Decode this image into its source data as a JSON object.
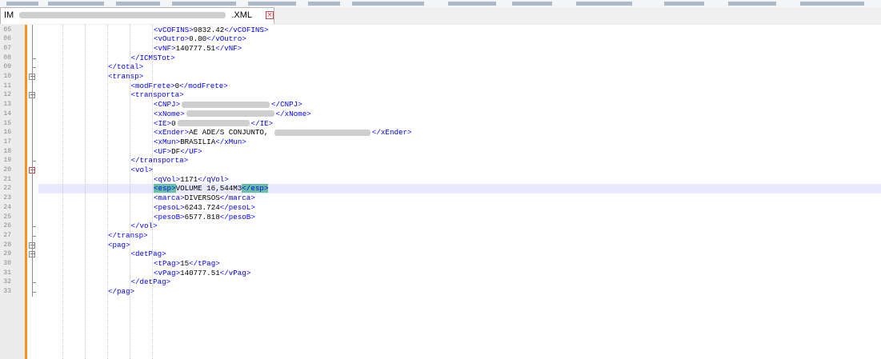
{
  "tab": {
    "label_prefix": "IM",
    "label_suffix": ".XML",
    "close_glyph": "×"
  },
  "editor": {
    "lines": [
      {
        "num": "05",
        "indent": 5,
        "tag": "vCOFINS",
        "value": "9832.42"
      },
      {
        "num": "06",
        "indent": 5,
        "tag": "vOutro",
        "value": "0.00"
      },
      {
        "num": "07",
        "indent": 5,
        "tag": "vNF",
        "value": "140777.51"
      },
      {
        "num": "08",
        "indent": 4,
        "close": "ICMSTot"
      },
      {
        "num": "09",
        "indent": 3,
        "close": "total"
      },
      {
        "num": "10",
        "indent": 3,
        "open": "transp"
      },
      {
        "num": "11",
        "indent": 4,
        "tag": "modFrete",
        "value": "0"
      },
      {
        "num": "12",
        "indent": 4,
        "open": "transporta"
      },
      {
        "num": "13",
        "indent": 5,
        "tag": "CNPJ",
        "redacted": true,
        "value": ""
      },
      {
        "num": "14",
        "indent": 5,
        "tag": "xNome",
        "redacted": true,
        "value": ""
      },
      {
        "num": "15",
        "indent": 5,
        "tag": "IE",
        "redacted": true,
        "value": "0"
      },
      {
        "num": "16",
        "indent": 5,
        "tag": "xEnder",
        "value": "AE ADE/S CONJUNTO,",
        "redacted_after": true
      },
      {
        "num": "17",
        "indent": 5,
        "tag": "xMun",
        "value": "BRASILIA"
      },
      {
        "num": "18",
        "indent": 5,
        "tag": "UF",
        "value": "DF"
      },
      {
        "num": "19",
        "indent": 4,
        "close": "transporta"
      },
      {
        "num": "20",
        "indent": 4,
        "open": "vol"
      },
      {
        "num": "21",
        "indent": 5,
        "tag": "qVol",
        "value": "1171"
      },
      {
        "num": "22",
        "indent": 5,
        "tag": "esp",
        "value": "VOLUME 16,544M3",
        "highlight": true
      },
      {
        "num": "23",
        "indent": 5,
        "tag": "marca",
        "value": "DIVERSOS"
      },
      {
        "num": "24",
        "indent": 5,
        "tag": "pesoL",
        "value": "6243.724"
      },
      {
        "num": "25",
        "indent": 5,
        "tag": "pesoB",
        "value": "6577.818"
      },
      {
        "num": "26",
        "indent": 4,
        "close": "vol"
      },
      {
        "num": "27",
        "indent": 3,
        "close": "transp"
      },
      {
        "num": "28",
        "indent": 3,
        "open": "pag"
      },
      {
        "num": "29",
        "indent": 4,
        "open": "detPag"
      },
      {
        "num": "30",
        "indent": 5,
        "tag": "tPag",
        "value": "15"
      },
      {
        "num": "31",
        "indent": 5,
        "tag": "vPag",
        "value": "140777.51"
      },
      {
        "num": "32",
        "indent": 4,
        "close": "detPag"
      },
      {
        "num": "33",
        "indent": 3,
        "close": "pag"
      }
    ]
  },
  "colors": {
    "tag": "#0000ff",
    "text": "#000000",
    "margin_bar": "#f7931e",
    "match_highlight": "#68c1a5",
    "current_line": "#e8e8ff"
  }
}
